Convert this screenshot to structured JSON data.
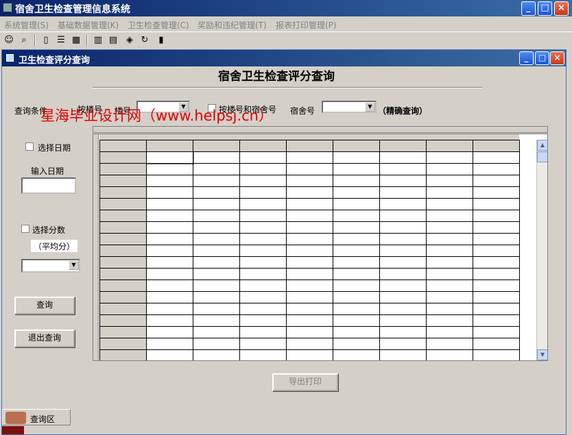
{
  "app": {
    "title": "宿舍卫生检查管理信息系统",
    "menu": [
      "系统管理(S)",
      "基础数据管理(K)",
      "卫生检查管理(C)",
      "奖励和违纪管理(T)",
      "报表打印管理(P)"
    ],
    "toolbar_icons": [
      "user-icon",
      "search-icon",
      "new-doc-icon",
      "list-icon",
      "keyboard-icon",
      "table-icon",
      "table-edit-icon",
      "chart-icon",
      "refresh-icon",
      "exit-icon"
    ]
  },
  "window": {
    "title": "卫生检查评分查询",
    "heading": "宿舍卫生检查评分查询"
  },
  "query": {
    "condition_label": "查询条件",
    "building_label": "按楼号",
    "building_num_label": "楼号",
    "building_value": "",
    "building_and_room_label": "按楼号和宿舍号",
    "room_label": "宿舍号",
    "room_value": "",
    "exact_note": "（精确查询）"
  },
  "watermark": "星海毕业设计网（www.helpsj.cn）",
  "left_panel": {
    "select_date_label": "选择日期",
    "input_date_label": "输入日期",
    "date_value": "",
    "select_score_label": "选择分数",
    "avg_label": "（平均分）",
    "score_value": "",
    "query_button": "查询",
    "exit_button": "退出查询"
  },
  "export_button": "导出打印",
  "status": {
    "label": "查询区"
  }
}
